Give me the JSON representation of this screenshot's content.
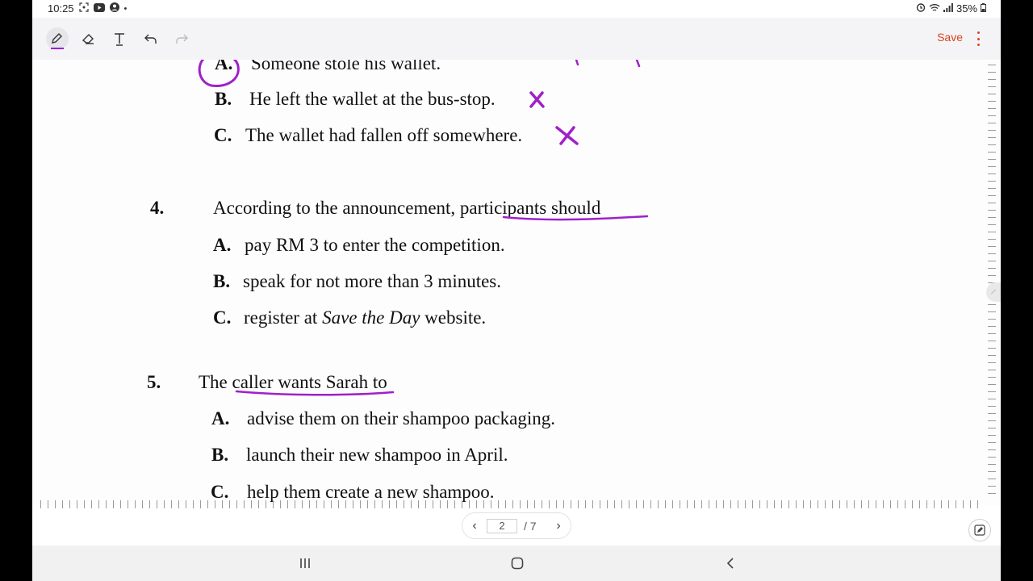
{
  "status_bar": {
    "time": "10:25",
    "left_icons": [
      "screenshot-icon",
      "youtube-icon",
      "account-icon",
      "dot-icon"
    ],
    "right_icons": [
      "alarm-icon",
      "wifi-icon",
      "signal-icon"
    ],
    "battery": "35%"
  },
  "toolbar": {
    "tools": [
      {
        "name": "pen",
        "icon": "pen-icon",
        "active": true
      },
      {
        "name": "eraser",
        "icon": "eraser-icon"
      },
      {
        "name": "text",
        "icon": "text-icon",
        "label": "T"
      },
      {
        "name": "undo",
        "icon": "undo-icon"
      },
      {
        "name": "redo",
        "icon": "redo-icon"
      }
    ],
    "save_label": "Save",
    "accent_color": "#d9431f",
    "pen_color": "#9b1fd6"
  },
  "document": {
    "q3_options": [
      {
        "letter": "A.",
        "text": "Someone stole his wallet."
      },
      {
        "letter": "B.",
        "text": "He left the wallet at the bus-stop."
      },
      {
        "letter": "C.",
        "text": "The wallet had fallen off somewhere."
      }
    ],
    "q4": {
      "number": "4.",
      "stem": "According to the announcement, participants should",
      "options": [
        {
          "letter": "A.",
          "text": "pay RM 3 to enter the competition."
        },
        {
          "letter": "B.",
          "text": "speak for not more than 3 minutes."
        },
        {
          "letter": "C.",
          "text_before": "register at ",
          "text_italic": "Save the Day",
          "text_after": " website."
        }
      ]
    },
    "q5": {
      "number": "5.",
      "stem": "The caller wants Sarah to",
      "options": [
        {
          "letter": "A.",
          "text": "advise them on their shampoo packaging."
        },
        {
          "letter": "B.",
          "text": "launch their new shampoo in April."
        },
        {
          "letter": "C.",
          "text": "help them create a new shampoo."
        }
      ]
    },
    "annotations": {
      "ink_color": "#a020c8",
      "marks": [
        "circle-around-q3-a",
        "cross-q3-b",
        "cross-q3-c",
        "underline-q4-participants-should",
        "underline-q5-caller-wants-sarah"
      ]
    }
  },
  "pager": {
    "current_page": "2",
    "total": "/ 7"
  },
  "nav_bar": {
    "buttons": [
      "recents-icon",
      "home-icon",
      "back-icon"
    ]
  }
}
